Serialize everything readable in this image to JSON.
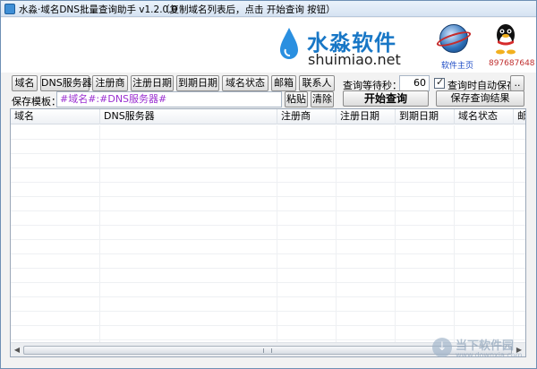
{
  "window": {
    "title": "水淼·域名DNS批量查询助手 v1.2.0.0",
    "hint": "（复制域名列表后，点击 开始查询 按钮）"
  },
  "banner": {
    "brand_name": "水淼软件",
    "brand_url": "shuimiao.net",
    "home_link": "软件主页",
    "qq_number": "897687648"
  },
  "fields": [
    {
      "label": "域名"
    },
    {
      "label": "DNS服务器"
    },
    {
      "label": "注册商"
    },
    {
      "label": "注册日期"
    },
    {
      "label": "到期日期"
    },
    {
      "label": "域名状态"
    },
    {
      "label": "邮箱"
    },
    {
      "label": "联系人"
    }
  ],
  "query": {
    "wait_label": "查询等待秒：",
    "wait_value": "60",
    "auto_save_label": "查询时自动保存",
    "auto_save_checked": true,
    "browse_button": "..",
    "start_button": "开始查询",
    "save_button": "保存查询结果"
  },
  "template": {
    "label": "保存模板：",
    "value": "#域名#:#DNS服务器#",
    "paste_button": "粘贴",
    "clear_button": "清除"
  },
  "table": {
    "columns": [
      "域名",
      "DNS服务器",
      "注册商",
      "注册日期",
      "到期日期",
      "域名状态",
      "邮"
    ],
    "rows": []
  },
  "watermark": {
    "text": "当下软件园",
    "sub": "www.downxia.com"
  },
  "colors": {
    "brand_blue": "#1877c6",
    "template_purple": "#9b2fd1",
    "qq_red": "#c03030"
  }
}
